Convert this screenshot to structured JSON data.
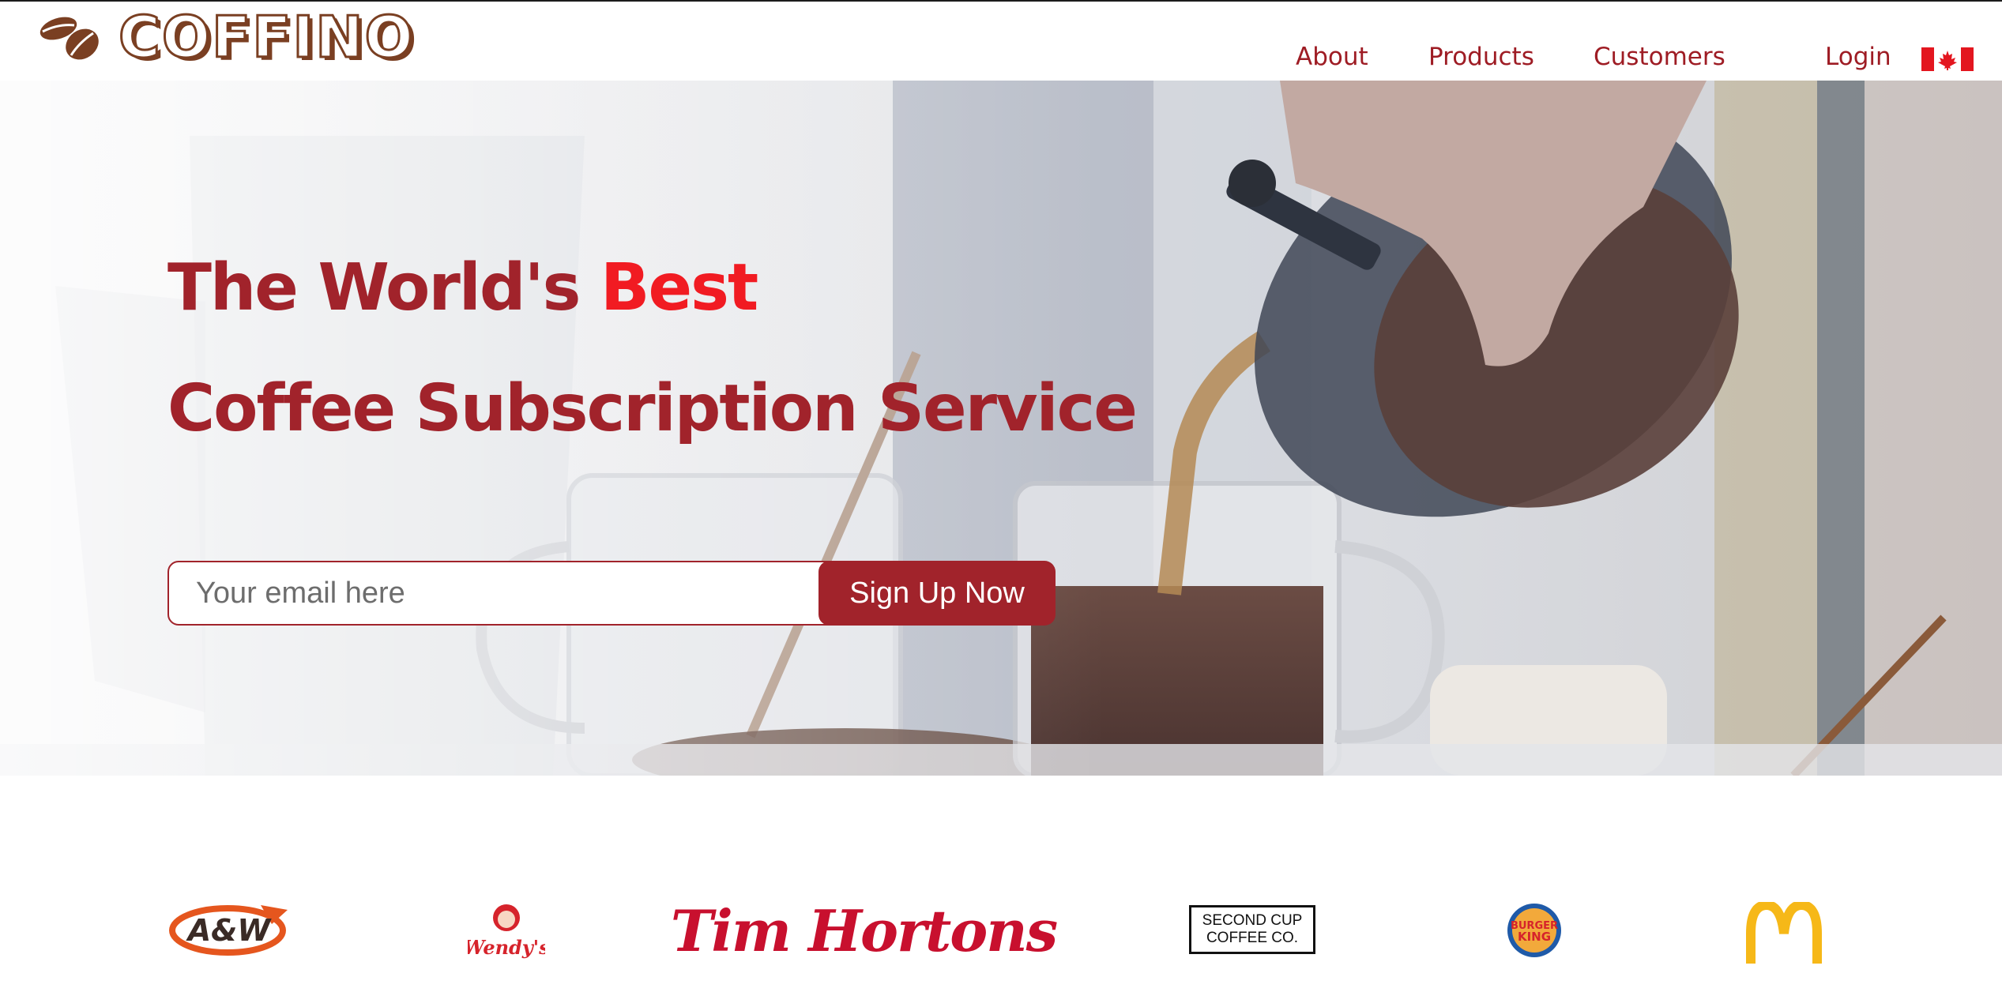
{
  "header": {
    "brand_name": "COFFINO",
    "nav": {
      "about": "About",
      "products": "Products",
      "customers": "Customers",
      "login": "Login"
    },
    "flag_icon": "canada-flag-icon"
  },
  "hero": {
    "title_line1_prefix": "The World's ",
    "title_line1_accent": "Best",
    "title_line2": "Coffee Subscription Service",
    "email_placeholder": "Your email here",
    "signup_button": "Sign Up Now"
  },
  "brands": {
    "aw": "A&W",
    "wendys": "Wendy's",
    "tim_hortons": "Tim Hortons",
    "second_cup_line1": "SECOND CUP",
    "second_cup_line2": "COFFEE CO.",
    "burger_king_line1": "BURGER",
    "burger_king_line2": "KING"
  },
  "colors": {
    "brand_red": "#a1232b",
    "accent_red": "#f11b22",
    "logo_brown": "#7a3f22"
  }
}
